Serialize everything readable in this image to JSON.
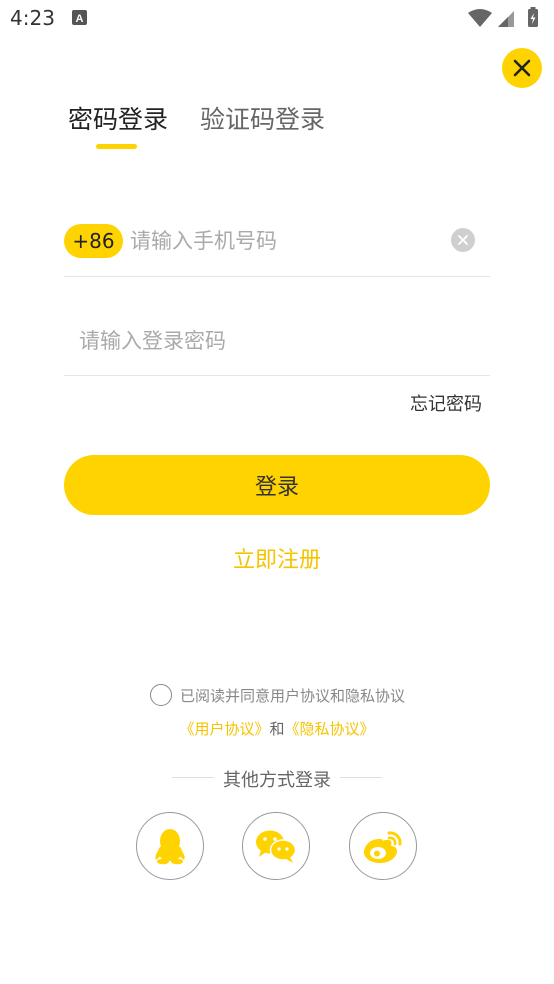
{
  "status_bar": {
    "time": "4:23"
  },
  "tabs": {
    "password_login": "密码登录",
    "sms_login": "验证码登录"
  },
  "phone": {
    "country_code": "+86",
    "placeholder": "请输入手机号码",
    "value": ""
  },
  "password": {
    "placeholder": "请输入登录密码",
    "value": ""
  },
  "forgot_password": "忘记密码",
  "login_button": "登录",
  "register_link": "立即注册",
  "agreement": {
    "text": "已阅读并同意用户协议和隐私协议",
    "user_agreement": "《用户协议》",
    "and": "和",
    "privacy_agreement": "《隐私协议》"
  },
  "other_login": {
    "label": "其他方式登录",
    "methods": [
      "qq-icon",
      "wechat-icon",
      "weibo-icon"
    ]
  },
  "colors": {
    "accent": "#FFD300",
    "link": "#F5C400",
    "muted": "#888888"
  }
}
